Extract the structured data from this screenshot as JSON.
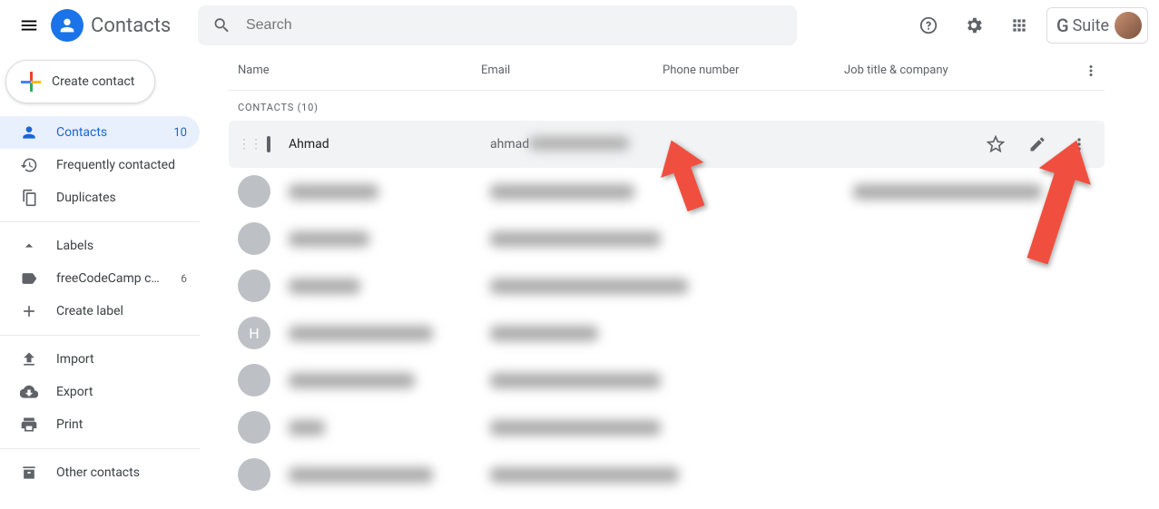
{
  "header": {
    "app_name": "Contacts",
    "search_placeholder": "Search",
    "gsuite_g": "G",
    "gsuite_suite": "Suite"
  },
  "sidebar": {
    "create_label": "Create contact",
    "items": [
      {
        "icon": "person",
        "label": "Contacts",
        "count": "10",
        "active": true
      },
      {
        "icon": "history",
        "label": "Frequently contacted"
      },
      {
        "icon": "copy",
        "label": "Duplicates"
      }
    ],
    "labels_header": "Labels",
    "labels": [
      {
        "label": "freeCodeCamp core t...",
        "count": "6"
      }
    ],
    "create_label_label": "Create label",
    "tools": [
      {
        "icon": "upload",
        "label": "Import"
      },
      {
        "icon": "cloud",
        "label": "Export"
      },
      {
        "icon": "print",
        "label": "Print"
      }
    ],
    "other": "Other contacts"
  },
  "table": {
    "header": {
      "name": "Name",
      "email": "Email",
      "phone": "Phone number",
      "job": "Job title & company"
    },
    "section_label": "CONTACTS (10)",
    "rows": [
      {
        "name": "Ahmad",
        "email": "ahmad",
        "hovered": true,
        "avatar": ""
      },
      {
        "name": "██████████",
        "email": "████████████████",
        "job": "█████████████████████",
        "avatar": "av1"
      },
      {
        "name": "█████████",
        "email": "███████████████████",
        "avatar": "av2"
      },
      {
        "name": "████████",
        "email": "██████████████████████",
        "avatar": "av3"
      },
      {
        "name": "████████████████",
        "email": "████████████",
        "avatar": "av4",
        "letter": "H"
      },
      {
        "name": "██████████████",
        "email": "███████████████████",
        "avatar": "av5"
      },
      {
        "name": "████",
        "email": "███████████████████",
        "avatar": "av6"
      },
      {
        "name": "████████████████",
        "email": "█████████████████████",
        "avatar": "av7"
      }
    ]
  }
}
